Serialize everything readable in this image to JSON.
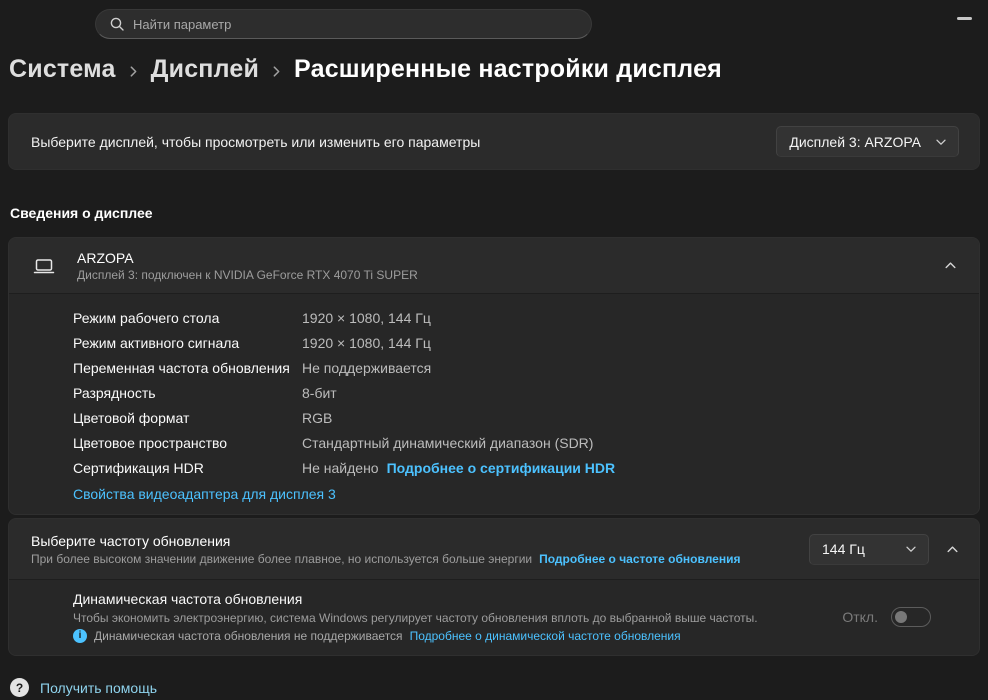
{
  "search": {
    "placeholder": "Найти параметр"
  },
  "breadcrumb": {
    "items": [
      "Система",
      "Дисплей",
      "Расширенные настройки дисплея"
    ]
  },
  "selector_card": {
    "label": "Выберите дисплей, чтобы просмотреть или изменить его параметры",
    "dropdown_value": "Дисплей 3: ARZOPA"
  },
  "details_section": {
    "heading": "Сведения о дисплее",
    "card": {
      "title": "ARZOPA",
      "subtitle": "Дисплей 3: подключен к NVIDIA GeForce RTX 4070 Ti SUPER",
      "rows": [
        {
          "label": "Режим рабочего стола",
          "value": "1920 × 1080, 144 Гц"
        },
        {
          "label": "Режим активного сигнала",
          "value": "1920 × 1080, 144 Гц"
        },
        {
          "label": "Переменная частота обновления",
          "value": "Не поддерживается"
        },
        {
          "label": "Разрядность",
          "value": "8-бит"
        },
        {
          "label": "Цветовой формат",
          "value": "RGB"
        },
        {
          "label": "Цветовое пространство",
          "value": "Стандартный динамический диапазон (SDR)"
        }
      ],
      "hdr_row": {
        "label": "Сертификация HDR",
        "value": "Не найдено",
        "link": "Подробнее о сертификации HDR"
      },
      "adapter_link": "Свойства видеоадаптера для дисплея 3"
    }
  },
  "refresh_section": {
    "title": "Выберите частоту обновления",
    "subtitle": "При более высоком значении движение более плавное, но используется больше энергии",
    "link": "Подробнее о частоте обновления",
    "dropdown_value": "144 Гц",
    "dynamic": {
      "title": "Динамическая частота обновления",
      "subtitle": "Чтобы экономить электроэнергию, система Windows регулирует частоту обновления вплоть до выбранной выше частоты.",
      "info_text": "Динамическая частота обновления не поддерживается",
      "info_link": "Подробнее о динамической частоте обновления",
      "toggle_label": "Откл.",
      "toggle_state": "off"
    }
  },
  "footer": {
    "help_label": "Получить помощь"
  },
  "colors": {
    "accent_link": "#4cc2ff",
    "page_bg": "#1c1c1c",
    "card_bg": "#2b2b2b"
  }
}
